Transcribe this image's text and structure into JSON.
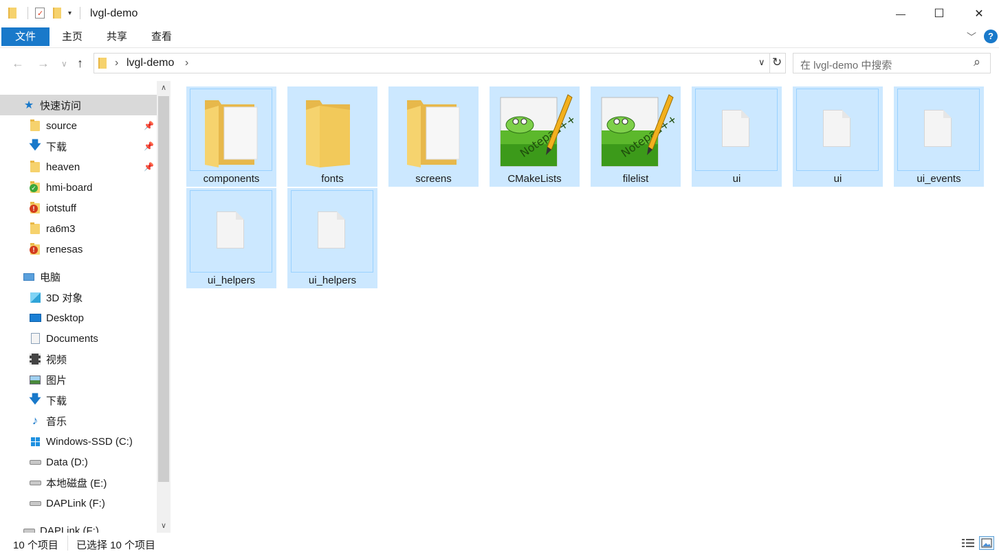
{
  "window": {
    "title": "lvgl-demo",
    "minimize": "—",
    "maximize": "☐",
    "close": "✕"
  },
  "ribbon": {
    "tabs": [
      "文件",
      "主页",
      "共享",
      "查看"
    ],
    "expand": "﹀",
    "help": "?"
  },
  "nav": {
    "back": "←",
    "forward": "→",
    "recent": "∨",
    "up": "↑",
    "breadcrumb_sep": "›",
    "breadcrumb": [
      "lvgl-demo"
    ],
    "dropdown": "∨",
    "refresh": "↻",
    "search_placeholder": "在 lvgl-demo 中搜索",
    "search_icon": "⌕"
  },
  "sidebar": {
    "quick_access": "快速访问",
    "quick_items": [
      {
        "label": "source",
        "pinned": true,
        "icon": "folder-icon"
      },
      {
        "label": "下载",
        "pinned": true,
        "icon": "download-icon"
      },
      {
        "label": "heaven",
        "pinned": true,
        "icon": "folder-icon"
      },
      {
        "label": "hmi-board",
        "pinned": false,
        "icon": "git-ok-folder-icon"
      },
      {
        "label": "iotstuff",
        "pinned": false,
        "icon": "git-alert-folder-icon"
      },
      {
        "label": "ra6m3",
        "pinned": false,
        "icon": "folder-icon"
      },
      {
        "label": "renesas",
        "pinned": false,
        "icon": "git-alert-folder-icon"
      }
    ],
    "this_pc": "电脑",
    "pc_items": [
      {
        "label": "3D 对象",
        "icon": "3d-objects-icon"
      },
      {
        "label": "Desktop",
        "icon": "desktop-icon"
      },
      {
        "label": "Documents",
        "icon": "documents-icon"
      },
      {
        "label": "视频",
        "icon": "videos-icon"
      },
      {
        "label": "图片",
        "icon": "pictures-icon"
      },
      {
        "label": "下载",
        "icon": "download-icon"
      },
      {
        "label": "音乐",
        "icon": "music-icon"
      },
      {
        "label": "Windows-SSD (C:)",
        "icon": "windows-drive-icon"
      },
      {
        "label": "Data (D:)",
        "icon": "drive-icon"
      },
      {
        "label": "本地磁盘 (E:)",
        "icon": "drive-icon"
      },
      {
        "label": "DAPLink (F:)",
        "icon": "drive-icon"
      }
    ],
    "network_partial": "DAPLink (F:)",
    "scroll_up": "∧",
    "scroll_down": "∨"
  },
  "files": [
    {
      "name": "components",
      "type": "folder"
    },
    {
      "name": "fonts",
      "type": "folder-empty"
    },
    {
      "name": "screens",
      "type": "folder"
    },
    {
      "name": "CMakeLists",
      "type": "notepad"
    },
    {
      "name": "filelist",
      "type": "notepad"
    },
    {
      "name": "ui",
      "type": "file"
    },
    {
      "name": "ui",
      "type": "file"
    },
    {
      "name": "ui_events",
      "type": "file"
    },
    {
      "name": "ui_helpers",
      "type": "file"
    },
    {
      "name": "ui_helpers",
      "type": "file"
    }
  ],
  "status": {
    "count": "10 个项目",
    "selected": "已选择 10 个项目"
  },
  "colors": {
    "accent": "#1979ca",
    "selection": "#cce8ff",
    "selection_border": "#99d1ff"
  }
}
